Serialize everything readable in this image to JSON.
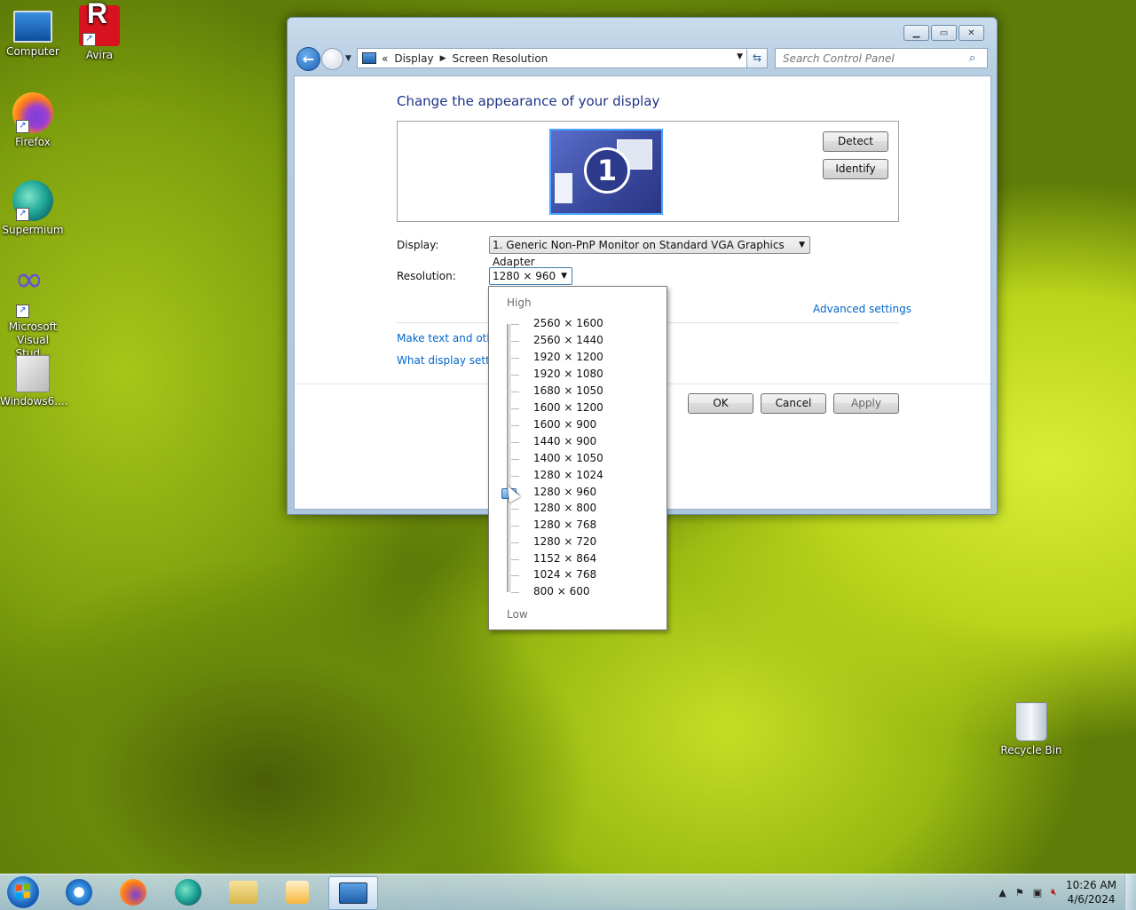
{
  "desktop": {
    "icons": [
      {
        "label": "Computer",
        "icon": "computer-icon"
      },
      {
        "label": "Avira",
        "icon": "avira-icon"
      },
      {
        "label": "Firefox",
        "icon": "firefox-icon"
      },
      {
        "label": "Supermium",
        "icon": "supermium-icon"
      },
      {
        "label": "Microsoft Visual Stud...",
        "icon": "visual-studio-icon"
      },
      {
        "label": "Windows6....",
        "icon": "installer-icon"
      },
      {
        "label": "Recycle Bin",
        "icon": "recycle-bin-icon"
      }
    ]
  },
  "window": {
    "breadcrumb": {
      "root": "Display",
      "current": "Screen Resolution"
    },
    "search_placeholder": "Search Control Panel",
    "heading": "Change the appearance of your display",
    "monitor_number": "1",
    "detect_label": "Detect",
    "identify_label": "Identify",
    "display_label": "Display:",
    "display_value": "1. Generic Non-PnP Monitor on Standard VGA Graphics Adapter",
    "resolution_label": "Resolution:",
    "resolution_value": "1280 × 960",
    "advanced_link": "Advanced settings",
    "link_text_size": "Make text and other",
    "link_display_settings": "What display setting",
    "ok_label": "OK",
    "cancel_label": "Cancel",
    "apply_label": "Apply"
  },
  "resolution_dropdown": {
    "high_label": "High",
    "low_label": "Low",
    "options": [
      "2560 × 1600",
      "2560 × 1440",
      "1920 × 1200",
      "1920 × 1080",
      "1680 × 1050",
      "1600 × 1200",
      "1600 × 900",
      "1440 × 900",
      "1400 × 1050",
      "1280 × 1024",
      "1280 × 960",
      "1280 × 800",
      "1280 × 768",
      "1280 × 720",
      "1152 × 864",
      "1024 × 768",
      "800 × 600"
    ],
    "selected_index": 10
  },
  "taskbar": {
    "clock_time": "10:26 AM",
    "clock_date": "4/6/2024",
    "pinned": [
      "internet-explorer-icon",
      "firefox-icon",
      "supermium-icon",
      "file-explorer-icon",
      "media-player-icon",
      "control-panel-icon"
    ]
  },
  "colors": {
    "accent_link": "#0066cc",
    "heading": "#1e3287"
  }
}
